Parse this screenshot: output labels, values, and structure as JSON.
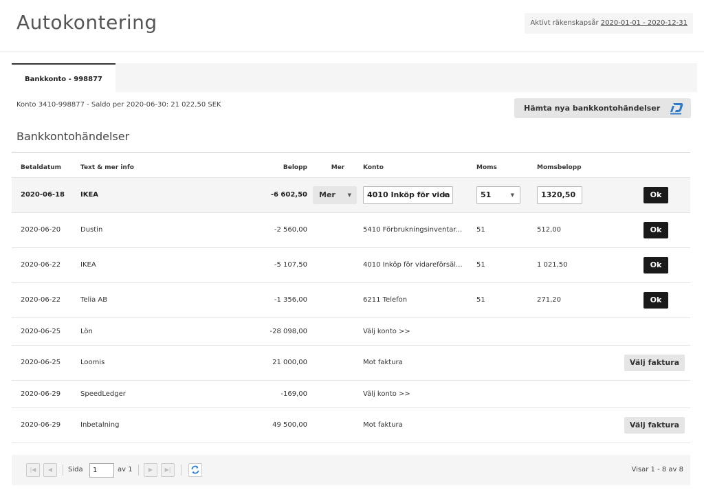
{
  "page": {
    "title": "Autokontering",
    "fiscal_label": "Aktivt räkenskapsår",
    "fiscal_range": "2020-01-01 - 2020-12-31"
  },
  "tab": {
    "label": "Bankkonto - 998877"
  },
  "account_info": "Konto 3410-998877 - Saldo per 2020-06-30: 21 022,50 SEK",
  "fetch_button": {
    "label": "Hämta nya bankkontohändelser",
    "icon": "bankid-icon"
  },
  "section_title": "Bankkontohändelser",
  "columns": [
    "Betaldatum",
    "Text & mer info",
    "Belopp",
    "Mer",
    "Konto",
    "Moms",
    "Momsbelopp",
    ""
  ],
  "rows": [
    {
      "date": "2020-06-18",
      "text": "IKEA",
      "amount": "-6 602,50",
      "mer": "Mer",
      "konto": "4010 Inköp för vida",
      "moms": "51",
      "momsbelopp": "1320,50",
      "action": "Ok",
      "editing": true
    },
    {
      "date": "2020-06-20",
      "text": "Dustin",
      "amount": "-2 560,00",
      "konto": "5410 Förbrukningsinventar...",
      "moms": "51",
      "momsbelopp": "512,00",
      "action": "Ok"
    },
    {
      "date": "2020-06-22",
      "text": "IKEA",
      "amount": "-5 107,50",
      "konto": "4010 Inköp för vidareförsäl...",
      "moms": "51",
      "momsbelopp": "1 021,50",
      "action": "Ok"
    },
    {
      "date": "2020-06-22",
      "text": "Telia AB",
      "amount": "-1 356,00",
      "konto": "6211 Telefon",
      "moms": "51",
      "momsbelopp": "271,20",
      "action": "Ok"
    },
    {
      "date": "2020-06-25",
      "text": "Lön",
      "amount": "-28 098,00",
      "konto": "Välj konto >>",
      "moms": "",
      "momsbelopp": "",
      "action": ""
    },
    {
      "date": "2020-06-25",
      "text": "Loomis",
      "amount": "21 000,00",
      "konto": "Mot faktura",
      "moms": "",
      "momsbelopp": "",
      "action": "Välj faktura"
    },
    {
      "date": "2020-06-29",
      "text": "SpeedLedger",
      "amount": "-169,00",
      "konto": "Välj konto >>",
      "moms": "",
      "momsbelopp": "",
      "action": ""
    },
    {
      "date": "2020-06-29",
      "text": "Inbetalning",
      "amount": "49 500,00",
      "konto": "Mot faktura",
      "moms": "",
      "momsbelopp": "",
      "action": "Välj faktura"
    }
  ],
  "pager": {
    "page_label": "Sida",
    "page_value": "1",
    "of_label": "av 1",
    "summary": "Visar 1 - 8 av 8"
  }
}
